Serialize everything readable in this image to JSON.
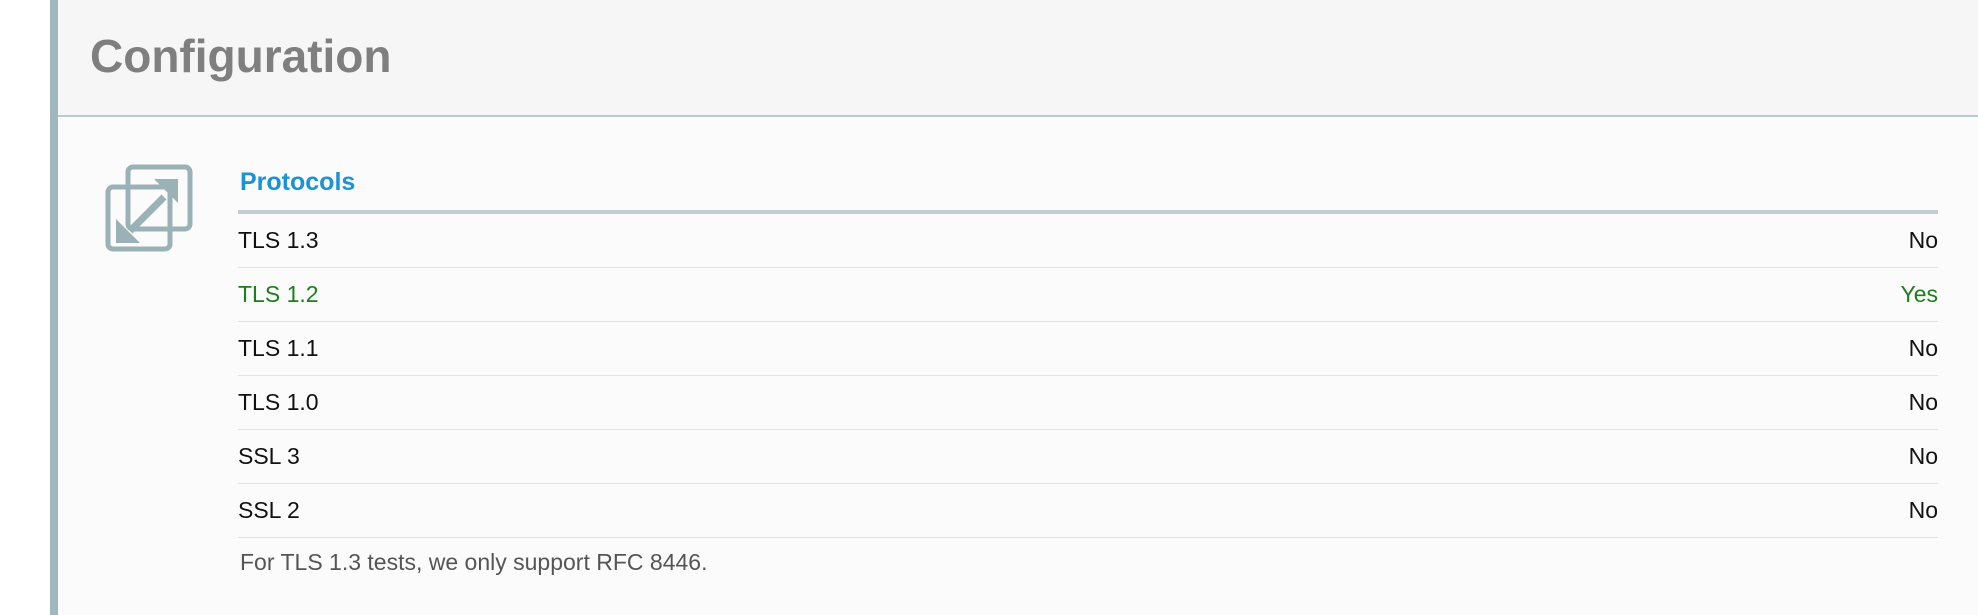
{
  "header": {
    "title": "Configuration"
  },
  "section": {
    "icon": "resize-arrows-icon",
    "title": "Protocols",
    "rows": [
      {
        "name": "TLS 1.3",
        "value": "No",
        "enabled": false
      },
      {
        "name": "TLS 1.2",
        "value": "Yes",
        "enabled": true
      },
      {
        "name": "TLS 1.1",
        "value": "No",
        "enabled": false
      },
      {
        "name": "TLS 1.0",
        "value": "No",
        "enabled": false
      },
      {
        "name": "SSL 3",
        "value": "No",
        "enabled": false
      },
      {
        "name": "SSL 2",
        "value": "No",
        "enabled": false
      }
    ],
    "footnote": "For TLS 1.3 tests, we only support RFC 8446."
  },
  "colors": {
    "section_title": "#1a93d6",
    "enabled_text": "#1c7e1c",
    "default_text": "#111111",
    "header_title": "#7f7f7f",
    "accent_rule": "#9fb8bd"
  }
}
